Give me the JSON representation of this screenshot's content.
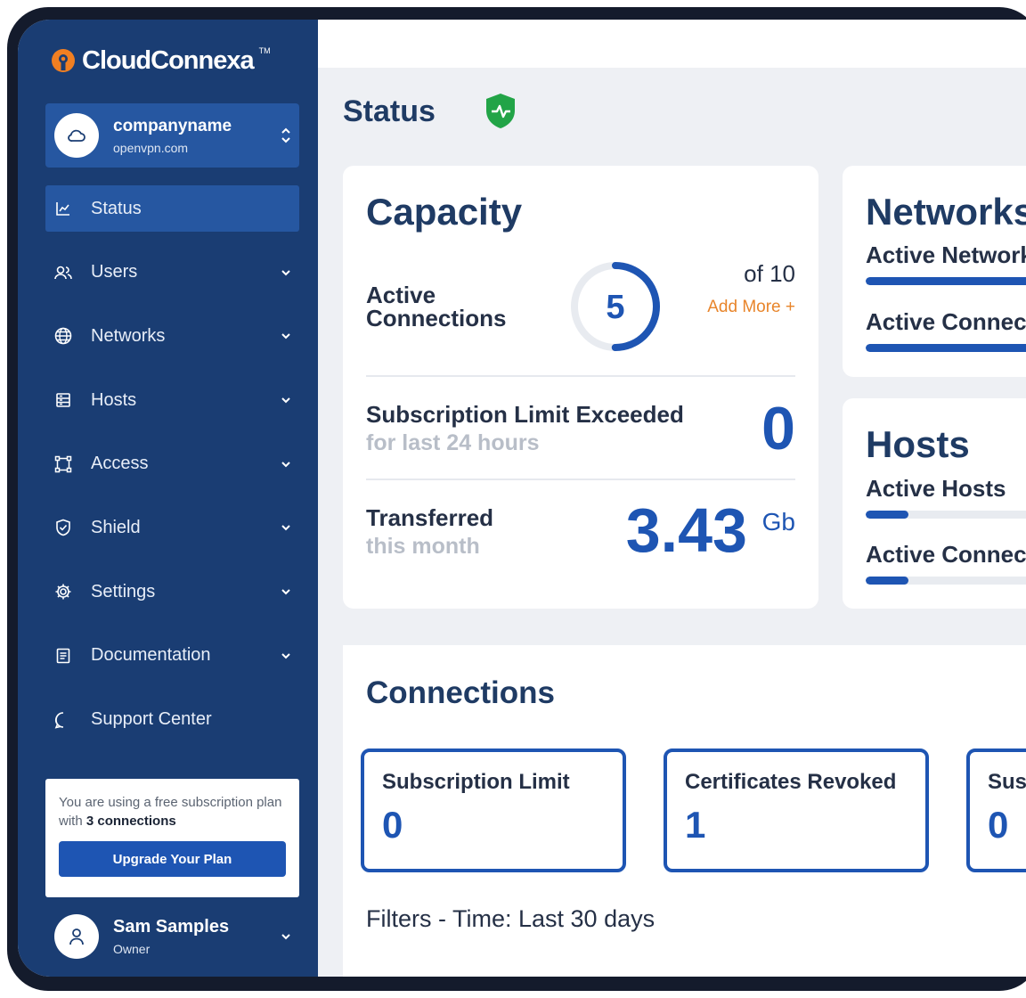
{
  "app": {
    "logo_text": "CloudConnexa",
    "logo_tm": "TM"
  },
  "org": {
    "name": "companyname",
    "domain": "openvpn.com"
  },
  "nav": {
    "items": [
      {
        "label": "Status",
        "icon": "chart-line-icon",
        "active": true
      },
      {
        "label": "Users",
        "icon": "users-icon"
      },
      {
        "label": "Networks",
        "icon": "globe-icon"
      },
      {
        "label": "Hosts",
        "icon": "server-icon"
      },
      {
        "label": "Access",
        "icon": "access-nodes-icon"
      },
      {
        "label": "Shield",
        "icon": "shield-check-icon"
      },
      {
        "label": "Settings",
        "icon": "gear-icon"
      },
      {
        "label": "Documentation",
        "icon": "document-icon"
      },
      {
        "label": "Support Center",
        "icon": "chat-bubble-icon"
      }
    ]
  },
  "plan": {
    "text_prefix": "You are using a free subscription plan with",
    "text_bold": "3 connections",
    "button": "Upgrade Your Plan"
  },
  "user": {
    "name": "Sam Samples",
    "role": "Owner"
  },
  "page": {
    "title": "Status"
  },
  "capacity": {
    "title": "Capacity",
    "active_label_line1": "Active",
    "active_label_line2": "Connections",
    "active_value": "5",
    "active_fraction": 0.5,
    "of_total": "of 10",
    "add_more": "Add More +",
    "limit_label": "Subscription Limit Exceeded",
    "limit_sub": "for last 24 hours",
    "limit_value": "0",
    "transfer_label": "Transferred",
    "transfer_sub": "this month",
    "transfer_value": "3.43",
    "transfer_unit": "Gb"
  },
  "networks": {
    "title": "Networks",
    "row1_label": "Active Networks",
    "row1_fraction": 1.0,
    "row2_label": "Active Connectors",
    "row2_fraction": 1.0
  },
  "hosts": {
    "title": "Hosts",
    "row1_label": "Active Hosts",
    "row1_fraction": 0.22,
    "row2_label": "Active Connectors",
    "row2_fraction": 0.22
  },
  "connections": {
    "title": "Connections",
    "stats": [
      {
        "label": "Subscription Limit",
        "value": "0"
      },
      {
        "label": "Certificates Revoked",
        "value": "1"
      },
      {
        "label": "Suspended",
        "value": "0"
      }
    ],
    "filters": "Filters - Time: Last 30 days"
  },
  "colors": {
    "sidebar": "#1a3d73",
    "active": "#2657a1",
    "accent": "#1e55b3",
    "orange": "#e8852b",
    "badge": "#22a447"
  }
}
